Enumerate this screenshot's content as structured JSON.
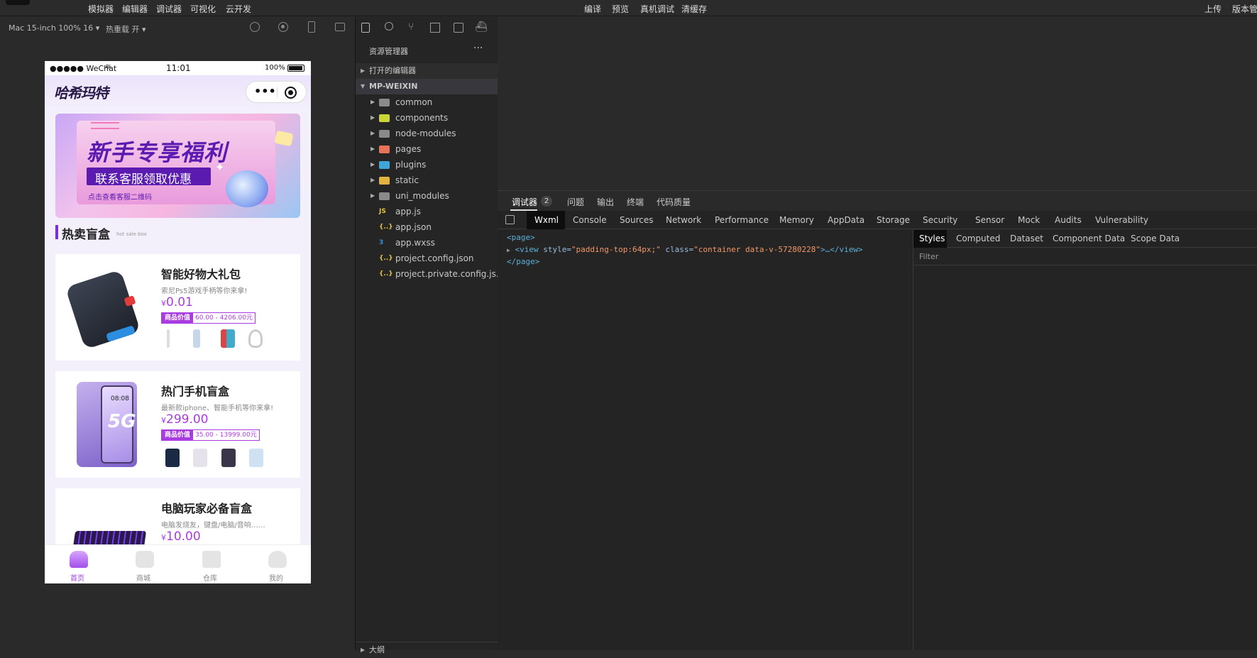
{
  "menubar": {
    "left": [
      "模拟器",
      "编辑器",
      "调试器",
      "可视化",
      "云开发"
    ],
    "center": [
      "编译",
      "预览",
      "真机调试",
      "清缓存"
    ],
    "right": [
      "上传",
      "版本管"
    ]
  },
  "simulator": {
    "device": "Mac 15-inch 100% 16",
    "hotreload": "热重载 开"
  },
  "phone": {
    "status": {
      "carrier": "●●●●● WeChat",
      "time": "11:01",
      "battery": "100%"
    },
    "logo": "哈希玛特",
    "banner": {
      "headline": "新手专享福利",
      "ribbon": "联系客服领取优惠",
      "sub": "点击查看客服二维码"
    },
    "section": {
      "title": "热卖盲盒",
      "sub": "hot sale box"
    },
    "products": [
      {
        "title": "智能好物大礼包",
        "desc": "索尼Ps5游戏手柄等你来拿!",
        "price": "0.01",
        "tag": "商品价值",
        "range": "60.00 - 4206.00元"
      },
      {
        "title": "热门手机盲盒",
        "desc": "最新款iphone、智能手机等你来拿!",
        "price": "299.00",
        "tag": "商品价值",
        "range": "35.00 - 13999.00元"
      },
      {
        "title": "电脑玩家必备盲盒",
        "desc": "电脑发烧友，键盘/电脑/音响……",
        "price": "10.00"
      }
    ],
    "currency": "¥",
    "tabbar": [
      "首页",
      "商城",
      "仓库",
      "我的"
    ]
  },
  "explorer": {
    "title": "资源管理器",
    "more": "···",
    "open_editors": "打开的编辑器",
    "root": "MP-WEIXIN",
    "items": [
      {
        "name": "common",
        "type": "folder",
        "color": "#8a8a8a"
      },
      {
        "name": "components",
        "type": "folder",
        "color": "#c9d638"
      },
      {
        "name": "node-modules",
        "type": "folder",
        "color": "#8a8a8a"
      },
      {
        "name": "pages",
        "type": "folder",
        "color": "#e8735a"
      },
      {
        "name": "plugins",
        "type": "folder",
        "color": "#3fa6d8"
      },
      {
        "name": "static",
        "type": "folder",
        "color": "#e3b341"
      },
      {
        "name": "uni_modules",
        "type": "folder",
        "color": "#8a8a8a"
      },
      {
        "name": "app.js",
        "type": "file",
        "icon": "JS",
        "color": "#e3c341"
      },
      {
        "name": "app.json",
        "type": "file",
        "icon": "{..}",
        "color": "#e3c341"
      },
      {
        "name": "app.wxss",
        "type": "file",
        "icon": "3",
        "color": "#3c8fd6"
      },
      {
        "name": "project.config.json",
        "type": "file",
        "icon": "{..}",
        "color": "#e3c341"
      },
      {
        "name": "project.private.config.js...",
        "type": "file",
        "icon": "{..}",
        "color": "#e3c341"
      }
    ],
    "bottom": "大纲"
  },
  "devtools": {
    "top_tabs": [
      "调试器",
      "问题",
      "输出",
      "终端",
      "代码质量"
    ],
    "badge": "2",
    "tabs": [
      "Wxml",
      "Console",
      "Sources",
      "Network",
      "Performance",
      "Memory",
      "AppData",
      "Storage",
      "Security",
      "Sensor",
      "Mock",
      "Audits",
      "Vulnerability"
    ],
    "code": {
      "l1": "<page>",
      "l2_tag": "<view",
      "l2_a1": " style=",
      "l2_v1": "\"padding-top:64px;\"",
      "l2_a2": " class=",
      "l2_v2": "\"container data-v-57280228\"",
      "l2_end": ">…</view>",
      "l3": "</page>"
    },
    "side_tabs": [
      "Styles",
      "Computed",
      "Dataset",
      "Component Data",
      "Scope Data"
    ],
    "filter": "Filter"
  }
}
